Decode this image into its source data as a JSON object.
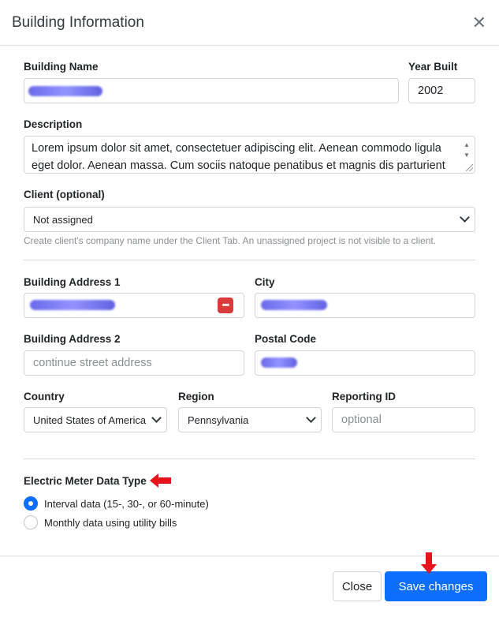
{
  "modal": {
    "title": "Building Information",
    "close_icon": "close-icon"
  },
  "form": {
    "building_name": {
      "label": "Building Name",
      "value": ""
    },
    "year_built": {
      "label": "Year Built",
      "value": "2002"
    },
    "description": {
      "label": "Description",
      "value": "Lorem ipsum dolor sit amet, consectetuer adipiscing elit. Aenean commodo ligula eget dolor. Aenean massa. Cum sociis natoque penatibus et magnis dis parturient"
    },
    "client": {
      "label": "Client (optional)",
      "selected": "Not assigned",
      "help": "Create client's company name under the Client Tab. An unassigned project is not visible to a client."
    },
    "address1": {
      "label": "Building Address 1",
      "value": ""
    },
    "city": {
      "label": "City",
      "value": ""
    },
    "address2": {
      "label": "Building Address 2",
      "placeholder": "continue street address"
    },
    "postal_code": {
      "label": "Postal Code",
      "value": ""
    },
    "country": {
      "label": "Country",
      "selected": "United States of America"
    },
    "region": {
      "label": "Region",
      "selected": "Pennsylvania"
    },
    "reporting_id": {
      "label": "Reporting ID",
      "placeholder": "optional"
    },
    "meter_type": {
      "label": "Electric Meter Data Type",
      "options": [
        {
          "label": "Interval data (15-, 30-, or 60-minute)",
          "checked": true
        },
        {
          "label": "Monthly data using utility bills",
          "checked": false
        }
      ]
    }
  },
  "footer": {
    "close_label": "Close",
    "save_label": "Save changes"
  },
  "colors": {
    "primary": "#0d6efd",
    "annotation_arrow": "#e8141b",
    "password_icon": "#d93a3a",
    "redaction": "#5050e6"
  }
}
